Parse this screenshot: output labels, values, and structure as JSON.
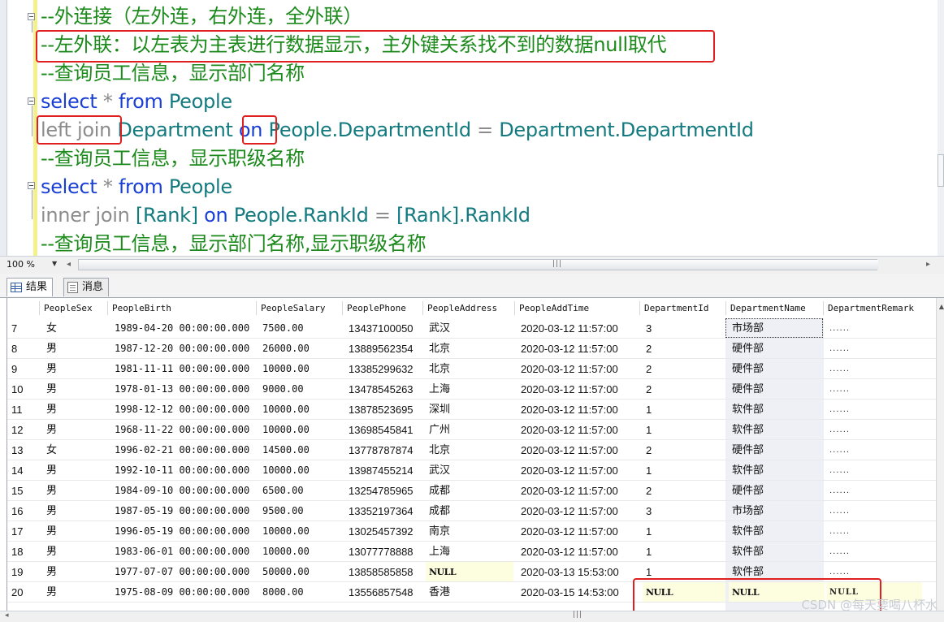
{
  "editor": {
    "lines": [
      {
        "id": "l1",
        "parts": [
          {
            "t": "--外连接（左外连，右外连，全外联）",
            "c": "comment"
          }
        ]
      },
      {
        "id": "l2",
        "parts": [
          {
            "t": "--左外联：以左表为主表进行数据显示，主外键关系找不到的数据null取代",
            "c": "comment"
          }
        ]
      },
      {
        "id": "l3",
        "parts": [
          {
            "t": "--查询员工信息，显示部门名称",
            "c": "comment"
          }
        ]
      },
      {
        "id": "l4",
        "parts": [
          {
            "t": "select",
            "c": "kw"
          },
          {
            "t": " * ",
            "c": "gray"
          },
          {
            "t": "from",
            "c": "kw"
          },
          {
            "t": " People",
            "c": "teal"
          }
        ]
      },
      {
        "id": "l5",
        "parts": [
          {
            "t": "left join",
            "c": "gray"
          },
          {
            "t": " Department ",
            "c": "teal"
          },
          {
            "t": "on",
            "c": "kw"
          },
          {
            "t": " People.DepartmentId ",
            "c": "teal"
          },
          {
            "t": "=",
            "c": "gray"
          },
          {
            "t": " Department.DepartmentId",
            "c": "teal"
          }
        ]
      },
      {
        "id": "l6",
        "parts": [
          {
            "t": "--查询员工信息，显示职级名称",
            "c": "comment"
          }
        ]
      },
      {
        "id": "l7",
        "parts": [
          {
            "t": "select",
            "c": "kw"
          },
          {
            "t": " * ",
            "c": "gray"
          },
          {
            "t": "from",
            "c": "kw"
          },
          {
            "t": " People",
            "c": "teal"
          }
        ]
      },
      {
        "id": "l8",
        "parts": [
          {
            "t": "inner join",
            "c": "gray"
          },
          {
            "t": " [Rank] ",
            "c": "teal"
          },
          {
            "t": "on",
            "c": "kw"
          },
          {
            "t": " People.RankId ",
            "c": "teal"
          },
          {
            "t": "=",
            "c": "gray"
          },
          {
            "t": " [Rank].RankId",
            "c": "teal"
          }
        ]
      },
      {
        "id": "l9",
        "parts": [
          {
            "t": "--查询员工信息，显示部门名称,显示职级名称",
            "c": "comment"
          }
        ]
      }
    ]
  },
  "zoombar": {
    "zoom": "100 %"
  },
  "tabs": {
    "results": "结果",
    "messages": "消息"
  },
  "grid": {
    "columns": [
      "PeopleSex",
      "PeopleBirth",
      "PeopleSalary",
      "PeoplePhone",
      "PeopleAddress",
      "PeopleAddTime",
      "DepartmentId",
      "DepartmentName",
      "DepartmentRemark"
    ],
    "rows": [
      [
        "7",
        "女",
        "1989-04-20 00:00:00.000",
        "7500.00",
        "13437100050",
        "武汉",
        "2020-03-12 11:57:00",
        "3",
        "市场部",
        "......"
      ],
      [
        "8",
        "男",
        "1987-12-20 00:00:00.000",
        "26000.00",
        "13889562354",
        "北京",
        "2020-03-12 11:57:00",
        "2",
        "硬件部",
        "......"
      ],
      [
        "9",
        "男",
        "1981-11-11 00:00:00.000",
        "10000.00",
        "13385299632",
        "北京",
        "2020-03-12 11:57:00",
        "2",
        "硬件部",
        "......"
      ],
      [
        "10",
        "男",
        "1978-01-13 00:00:00.000",
        "9000.00",
        "13478545263",
        "上海",
        "2020-03-12 11:57:00",
        "2",
        "硬件部",
        "......"
      ],
      [
        "11",
        "男",
        "1998-12-12 00:00:00.000",
        "10000.00",
        "13878523695",
        "深圳",
        "2020-03-12 11:57:00",
        "1",
        "软件部",
        "......"
      ],
      [
        "12",
        "男",
        "1968-11-22 00:00:00.000",
        "10000.00",
        "13698545841",
        "广州",
        "2020-03-12 11:57:00",
        "1",
        "软件部",
        "......"
      ],
      [
        "13",
        "女",
        "1996-02-21 00:00:00.000",
        "14500.00",
        "13778787874",
        "北京",
        "2020-03-12 11:57:00",
        "2",
        "硬件部",
        "......"
      ],
      [
        "14",
        "男",
        "1992-10-11 00:00:00.000",
        "10000.00",
        "13987455214",
        "武汉",
        "2020-03-12 11:57:00",
        "1",
        "软件部",
        "......"
      ],
      [
        "15",
        "男",
        "1984-09-10 00:00:00.000",
        "6500.00",
        "13254785965",
        "成都",
        "2020-03-12 11:57:00",
        "2",
        "硬件部",
        "......"
      ],
      [
        "16",
        "男",
        "1987-05-19 00:00:00.000",
        "9500.00",
        "13352197364",
        "成都",
        "2020-03-12 11:57:00",
        "3",
        "市场部",
        "......"
      ],
      [
        "17",
        "男",
        "1996-05-19 00:00:00.000",
        "10000.00",
        "13025457392",
        "南京",
        "2020-03-12 11:57:00",
        "1",
        "软件部",
        "......"
      ],
      [
        "18",
        "男",
        "1983-06-01 00:00:00.000",
        "10000.00",
        "13077778888",
        "上海",
        "2020-03-12 11:57:00",
        "1",
        "软件部",
        "......"
      ],
      [
        "19",
        "男",
        "1977-07-07 00:00:00.000",
        "50000.00",
        "13858585858",
        "NULL",
        "2020-03-13 15:53:00",
        "1",
        "软件部",
        "......"
      ],
      [
        "20",
        "男",
        "1975-08-09 00:00:00.000",
        "8000.00",
        "13556857548",
        "香港",
        "2020-03-15 14:53:00",
        "NULL",
        "NULL",
        "NULL"
      ]
    ]
  },
  "watermark": "CSDN @每天要喝八杯水",
  "colors": {
    "comment": "#1b8a1b",
    "keyword": "#1a3fd6",
    "identifier": "#137a7f",
    "highlight": "#e02020"
  }
}
